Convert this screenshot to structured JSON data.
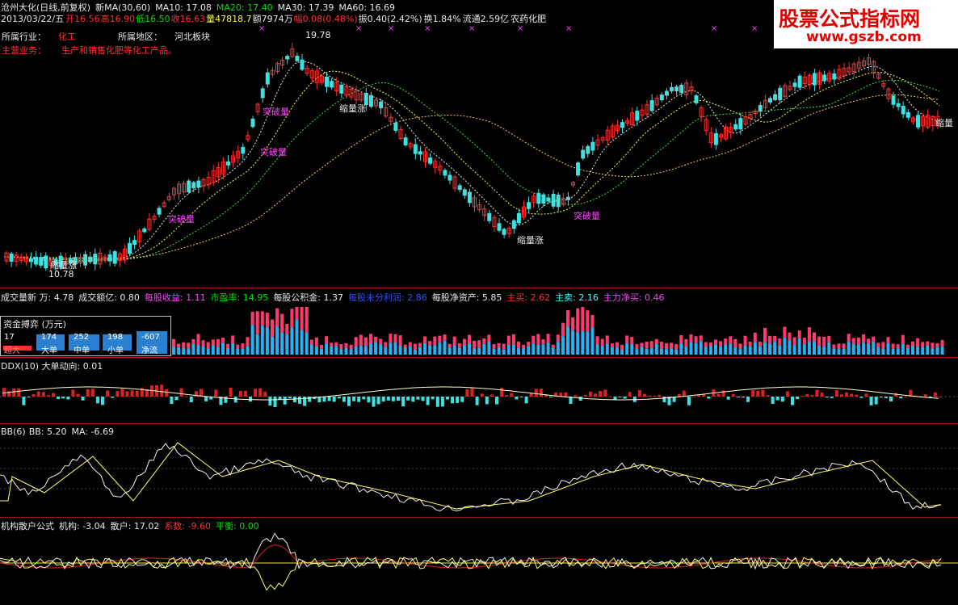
{
  "header": {
    "stock": "沧州大化(日线,前复权)",
    "ma_name": "新MA(30,60)",
    "ma10": "MA10: 17.08",
    "ma20": "MA20: 17.40",
    "ma30": "MA30: 17.39",
    "ma60": "MA60: 16.69",
    "date": "2013/03/22/五",
    "open": "开16.56",
    "high": "高16.90",
    "low": "低16.50",
    "close": "收16.63",
    "volume": "量47818.7",
    "amount": "额7974万",
    "change": "幅0.08(0.48%)",
    "amplitude": "振0.40(2.42%)",
    "turnover": "换1.84%",
    "float_cap": "流通2.59亿",
    "sector_tag": "农药化肥"
  },
  "info": {
    "industry_label": "所属行业：",
    "industry_value": "化工",
    "region_label": "所属地区：",
    "region_value": "河北板块",
    "business_label": "主营业务：",
    "business_value": "生产和销售化肥等化工产品。"
  },
  "price_chart": {
    "high_mark": "19.78",
    "low_mark": "10.78",
    "annotations": [
      "突破量",
      "突破量",
      "突破量",
      "缩量涨",
      "缩量涨",
      "突破量",
      "缩量涨",
      "缩量"
    ]
  },
  "logo": {
    "title": "股票公式指标网",
    "url": "www.gszb.com"
  },
  "volume_bar": {
    "vol": "成交量新 万: 4.78",
    "amt": "成交额亿: 0.80",
    "eps": "每股收益: 1.11",
    "pe": "市盈率: 14.95",
    "reserve": "每股公积金: 1.37",
    "undistributed": "每股未分利润: 2.86",
    "nav": "每股净资产: 5.85",
    "main_buy": "主买: 2.62",
    "main_sell": "主卖: 2.16",
    "main_net": "主力净买: 0.46"
  },
  "fund": {
    "title": "资金搏弈 (万元)",
    "cells": [
      {
        "value": "17",
        "label": "超大"
      },
      {
        "value": "174",
        "label": "大单"
      },
      {
        "value": "252",
        "label": "中单"
      },
      {
        "value": "198",
        "label": "小单"
      },
      {
        "value": "-607",
        "label": "净流"
      }
    ]
  },
  "ddx": {
    "label": "DDX(10) 大单动向: 0.01"
  },
  "bb": {
    "label": "BB(6)",
    "bb": "BB: 5.20",
    "ma": "MA: -6.69"
  },
  "inst": {
    "label": "机构散户公式",
    "jg": "机构: -3.04",
    "sh": "散户: 17.02",
    "xs": "系数: -9.60",
    "ph": "平衡: 0.00"
  },
  "colors": {
    "up": "#ff3030",
    "down": "#40e0e0",
    "bg": "#000000"
  }
}
